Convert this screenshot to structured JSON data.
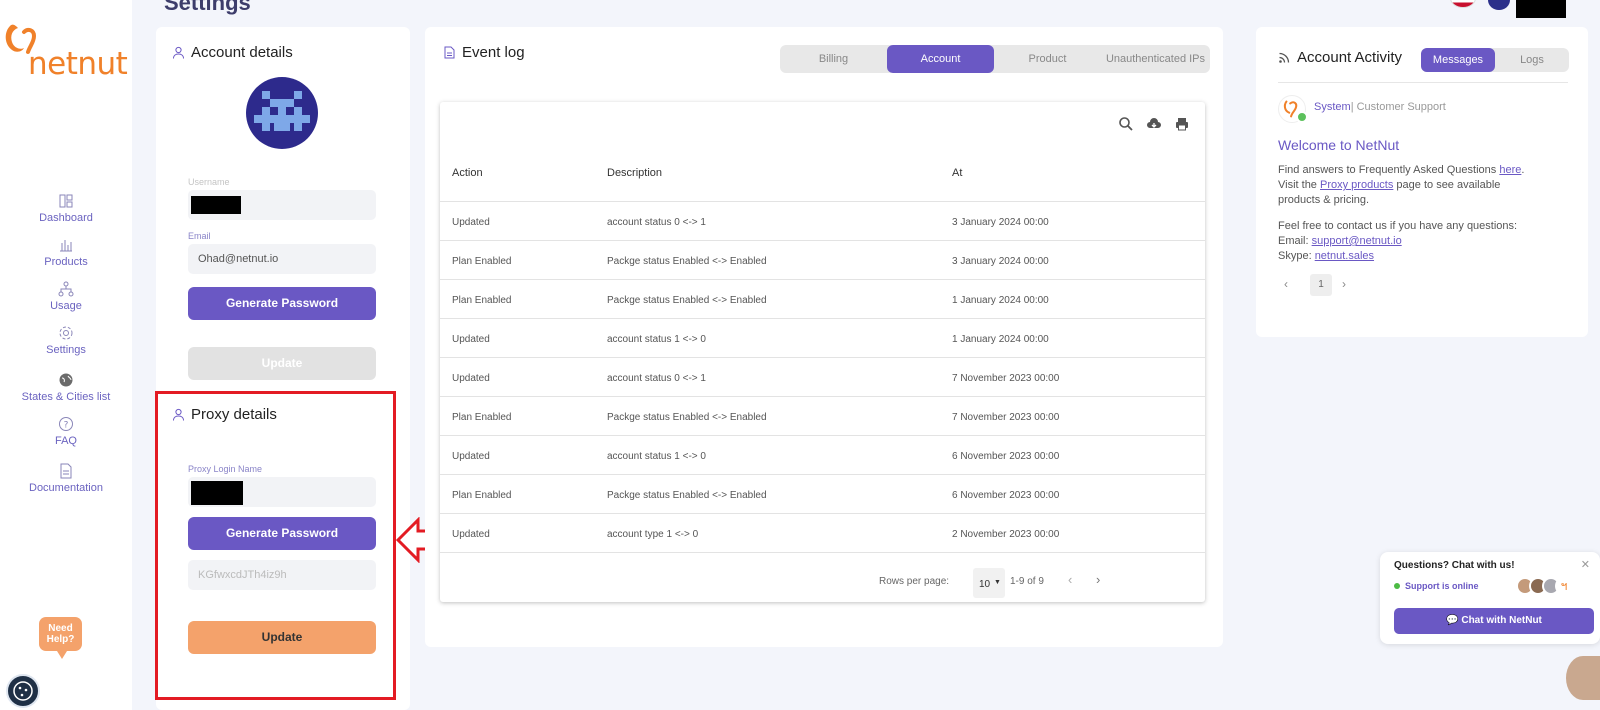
{
  "app": {
    "brand": "netnut",
    "page_title": "Settings"
  },
  "sidebar": {
    "items": [
      {
        "label": "Dashboard",
        "icon": "dashboard-icon"
      },
      {
        "label": "Products",
        "icon": "bar-chart-icon"
      },
      {
        "label": "Usage",
        "icon": "hierarchy-icon"
      },
      {
        "label": "Settings",
        "icon": "gear-icon"
      },
      {
        "label": "States & Cities list",
        "icon": "globe-icon"
      },
      {
        "label": "FAQ",
        "icon": "question-icon"
      },
      {
        "label": "Documentation",
        "icon": "document-icon"
      }
    ],
    "need_help": "Need Help?"
  },
  "account": {
    "title": "Account details",
    "username_label": "Username",
    "email_label": "Email",
    "email_value": "Ohad@netnut.io",
    "generate_password": "Generate Password",
    "update": "Update"
  },
  "proxy": {
    "title": "Proxy details",
    "login_label": "Proxy Login Name",
    "generate_password": "Generate Password",
    "password_value": "KGfwxcdJTh4iz9h",
    "update": "Update"
  },
  "event_log": {
    "title": "Event log",
    "tabs": [
      "Billing",
      "Account",
      "Product",
      "Unauthenticated IPs"
    ],
    "active_tab": "Account",
    "columns": [
      "Action",
      "Description",
      "At"
    ],
    "rows": [
      {
        "action": "Updated",
        "description": "account status 0 <-> 1",
        "at": "3 January 2024 00:00"
      },
      {
        "action": "Plan Enabled",
        "description": "Packge status Enabled <-> Enabled",
        "at": "3 January 2024 00:00"
      },
      {
        "action": "Plan Enabled",
        "description": "Packge status Enabled <-> Enabled",
        "at": "1 January 2024 00:00"
      },
      {
        "action": "Updated",
        "description": "account status 1 <-> 0",
        "at": "1 January 2024 00:00"
      },
      {
        "action": "Updated",
        "description": "account status 0 <-> 1",
        "at": "7 November 2023 00:00"
      },
      {
        "action": "Plan Enabled",
        "description": "Packge status Enabled <-> Enabled",
        "at": "7 November 2023 00:00"
      },
      {
        "action": "Updated",
        "description": "account status 1 <-> 0",
        "at": "6 November 2023 00:00"
      },
      {
        "action": "Plan Enabled",
        "description": "Packge status Enabled <-> Enabled",
        "at": "6 November 2023 00:00"
      },
      {
        "action": "Updated",
        "description": "account type 1 <-> 0",
        "at": "2 November 2023 00:00"
      }
    ],
    "rows_per_page_label": "Rows per page:",
    "rows_per_page": "10",
    "range": "1-9 of 9"
  },
  "activity": {
    "title": "Account Activity",
    "tabs": [
      "Messages",
      "Logs"
    ],
    "sender_name": "System",
    "sender_role": "| Customer Support",
    "welcome": "Welcome to NetNut",
    "line1_pre": "Find answers to Frequently Asked Questions ",
    "line1_link": "here",
    "line1_post": ".",
    "line2_pre": "Visit the ",
    "line2_link": "Proxy products",
    "line2_post": " page to see available",
    "line3": "products & pricing.",
    "line4": "Feel free to contact us if you have any questions:",
    "email_label": "Email: ",
    "email_link": "support@netnut.io",
    "skype_label": "Skype: ",
    "skype_link": "netnut.sales",
    "page": "1"
  },
  "chat": {
    "title": "Questions? Chat with us!",
    "status": "Support is online",
    "button": "Chat with NetNut"
  },
  "colors": {
    "accent": "#6a58c4",
    "orange": "#f4a26b",
    "highlight": "#e31b23"
  }
}
